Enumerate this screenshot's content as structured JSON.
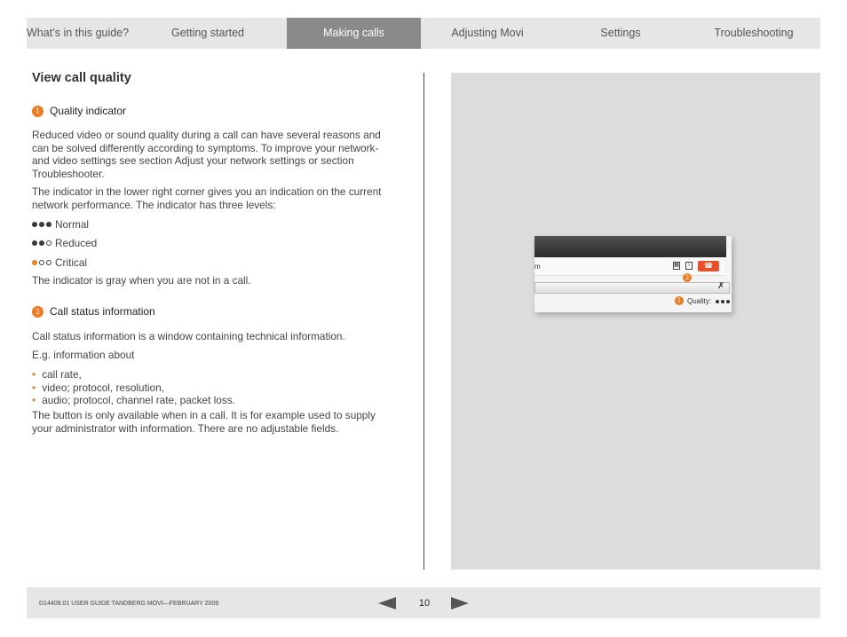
{
  "nav": {
    "tabs": [
      {
        "label": "What’s in this guide?"
      },
      {
        "label": "Getting started"
      },
      {
        "label": "Making calls",
        "active": true
      },
      {
        "label": "Adjusting Movi"
      },
      {
        "label": "Settings"
      },
      {
        "label": "Troubleshooting"
      }
    ]
  },
  "content": {
    "title": "View call quality",
    "section1": {
      "number": "1",
      "heading": "Quality indicator",
      "para1": "Reduced video or sound quality during a call can have several reasons and can be solved differently according to symptoms.  To improve your network- and video settings see section Adjust your network settings or section Troubleshooter.",
      "para2": "The indicator in the lower right corner gives you an indication on the current network performance.   The indicator has three levels:",
      "levels": [
        {
          "label": "Normal",
          "filled": 3
        },
        {
          "label": "Reduced",
          "filled": 2
        },
        {
          "label": "Critical",
          "filled": 1
        }
      ],
      "para3": "The indicator is gray when you are not in a call."
    },
    "section2": {
      "number": "2",
      "heading": "Call status information",
      "para1": "Call status information is a window containing technical information.",
      "para2": "E.g. information about",
      "bullets": [
        "call rate,",
        "video; protocol, resolution,",
        "audio; protocol, channel rate, packet loss."
      ],
      "para3": "The button is only available when in a call. It is for example used to supply your administrator with information.  There are no adjustable fields."
    }
  },
  "screenshot": {
    "fragment_text": "m",
    "badge_1": "1",
    "badge_2": "2",
    "quality_label": "Quality:"
  },
  "footer": {
    "doc_id": "D14409.01 USER GUIDE TANDBERG MOVI—FEBRUARY 2009",
    "page_number": "10"
  },
  "colors": {
    "accent": "#ee7a22",
    "active_tab": "#8a8a8a",
    "nav_bg": "#e6e6e6",
    "panel_bg": "#dcdcdc"
  }
}
